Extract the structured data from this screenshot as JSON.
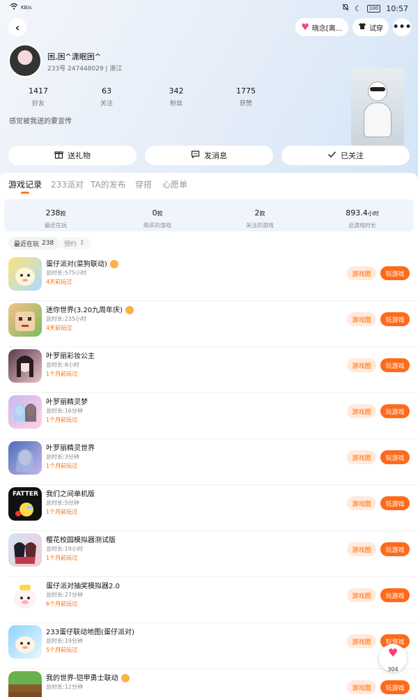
{
  "status": {
    "time": "10:57",
    "battery": "100",
    "network": "KB/s"
  },
  "header": {
    "mood_label": "晓念[离…",
    "tryon_label": "试穿",
    "more_label": "•••"
  },
  "profile": {
    "username": "困,困^潇眠困^",
    "id_line": "233号 247448029 | 浙江",
    "stats": [
      {
        "value": "1417",
        "label": "好友"
      },
      {
        "value": "63",
        "label": "关注"
      },
      {
        "value": "342",
        "label": "粉丝"
      },
      {
        "value": "1775",
        "label": "获赞"
      }
    ],
    "bio": "感觉被我送的要宣传"
  },
  "actions": {
    "gift": "送礼物",
    "message": "发消息",
    "followed": "已关注"
  },
  "tabs": [
    "游戏记录",
    "233派对",
    "TA的发布",
    "穿搭",
    "心愿单"
  ],
  "summary": [
    {
      "value": "238",
      "unit": "款",
      "label": "最近在玩"
    },
    {
      "value": "0",
      "unit": "款",
      "label": "购买的游戏"
    },
    {
      "value": "2",
      "unit": "款",
      "label": "关注的游戏"
    },
    {
      "value": "893.4",
      "unit": "小时",
      "label": "总游戏时长"
    }
  ],
  "filters": {
    "recent": "最近在玩",
    "recent_count": "238",
    "booked": "预约"
  },
  "button_labels": {
    "circle": "游戏圈",
    "play": "玩游戏"
  },
  "games": [
    {
      "title": "蛋仔派对(菜狗联动)",
      "duration": "总时长:575小时",
      "ago": "4天前玩过",
      "badge": true
    },
    {
      "title": "迷你世界(3.20九周年庆)",
      "duration": "总时长:235小时",
      "ago": "4天前玩过",
      "badge": true
    },
    {
      "title": "叶罗丽彩妆公主",
      "duration": "总时长:8小时",
      "ago": "1个月前玩过",
      "badge": false
    },
    {
      "title": "叶罗丽精灵梦",
      "duration": "总时长:16分钟",
      "ago": "1个月前玩过",
      "badge": false
    },
    {
      "title": "叶罗丽精灵世界",
      "duration": "总时长:3分钟",
      "ago": "1个月前玩过",
      "badge": false
    },
    {
      "title": "我们之间单机版",
      "duration": "总时长:5分钟",
      "ago": "1个月前玩过",
      "badge": false
    },
    {
      "title": "樱花校园模拟器测试版",
      "duration": "总时长:19小时",
      "ago": "1个月前玩过",
      "badge": false
    },
    {
      "title": "蛋仔派对抽奖模拟器2.0",
      "duration": "总时长:27分钟",
      "ago": "6个月前玩过",
      "badge": false
    },
    {
      "title": "233蛋仔联动地图(蛋仔派对)",
      "duration": "总时长:19分钟",
      "ago": "5个月前玩过",
      "badge": false
    },
    {
      "title": "我的世界-铠甲勇士联动",
      "duration": "总时长:12分钟",
      "ago": "",
      "badge": true
    }
  ],
  "like_count": "304",
  "colors": {
    "accent": "#ff6a1a",
    "accent_light": "#ffe9dc",
    "summary_bg": "#f0f5fb"
  }
}
